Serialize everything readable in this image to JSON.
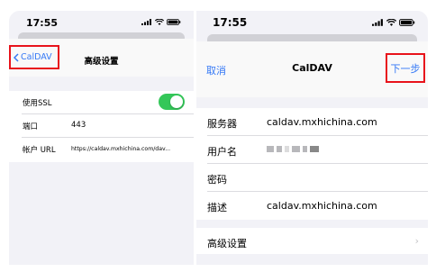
{
  "left_panel": {
    "time": "17:55",
    "nav": {
      "back_label": "CalDAV",
      "title": "高级设置"
    },
    "rows": [
      {
        "label": "使用SSL",
        "toggle_on": true
      },
      {
        "label": "端口",
        "value": "443"
      },
      {
        "label": "帐户 URL",
        "value": "https://caldav.mxhichina.com/dav..."
      }
    ]
  },
  "right_panel": {
    "time": "17:55",
    "nav": {
      "cancel_label": "取消",
      "title": "CalDAV",
      "next_label": "下一步"
    },
    "rows": [
      {
        "label": "服务器",
        "value": "caldav.mxhichina.com"
      },
      {
        "label": "用户名"
      },
      {
        "label": "密码",
        "value": ""
      },
      {
        "label": "描述",
        "value": "caldav.mxhichina.com"
      }
    ],
    "advanced_label": "高级设置"
  },
  "colors": {
    "accent": "#3478f6",
    "highlight_border": "#e8131b",
    "toggle_on": "#34c759"
  }
}
